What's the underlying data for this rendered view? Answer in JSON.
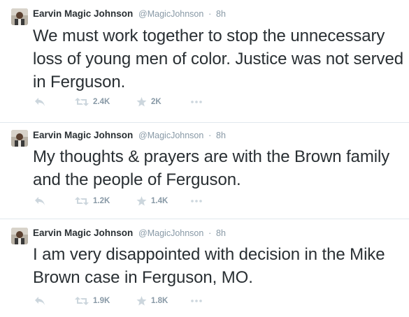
{
  "tweets": [
    {
      "fullname": "Earvin Magic Johnson",
      "handle": "@MagicJohnson",
      "separator": "·",
      "time": "8h",
      "text": "We must work together to stop the unnecessary loss of young men of color. Justice was not served in Ferguson.",
      "retweets": "2.4K",
      "favorites": "2K"
    },
    {
      "fullname": "Earvin Magic Johnson",
      "handle": "@MagicJohnson",
      "separator": "·",
      "time": "8h",
      "text": "My thoughts & prayers are with the Brown family and the people of Ferguson.",
      "retweets": "1.2K",
      "favorites": "1.4K"
    },
    {
      "fullname": "Earvin Magic Johnson",
      "handle": "@MagicJohnson",
      "separator": "·",
      "time": "8h",
      "text": "I am very disappointed with decision in the Mike Brown case in Ferguson, MO.",
      "retweets": "1.9K",
      "favorites": "1.8K"
    }
  ],
  "icons": {
    "reply": "reply-icon",
    "retweet": "retweet-icon",
    "favorite": "star-icon",
    "more": "more-dots-icon"
  },
  "colors": {
    "text": "#292f33",
    "muted": "#8899a6",
    "icon": "#ccd6dd",
    "divider": "#e1e8ed"
  }
}
